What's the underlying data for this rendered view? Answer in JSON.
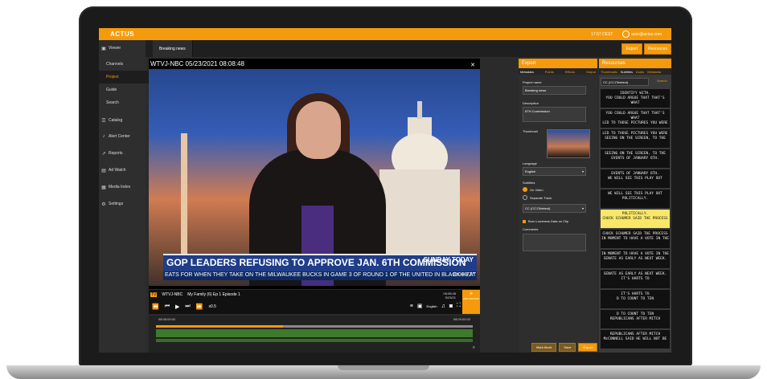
{
  "app": {
    "logo": "ACTUS",
    "top_right_left": "17:57 CEST",
    "user": "user@actus.com"
  },
  "header": {
    "tab": "Breaking news",
    "export_btn": "Export",
    "resources_btn": "Resources"
  },
  "sidebar": {
    "items": [
      {
        "label": "Viewer",
        "icon": "viewer-icon"
      },
      {
        "label": "Channels"
      },
      {
        "label": "Project"
      },
      {
        "label": "Guide"
      },
      {
        "label": "Search"
      },
      {
        "label": "Catalog",
        "icon": "catalog-icon"
      },
      {
        "label": "Alert Center",
        "icon": "bell-icon"
      },
      {
        "label": "Reports",
        "icon": "chart-icon"
      },
      {
        "label": "Ad Watch",
        "icon": "ad-icon"
      },
      {
        "label": "Media Index",
        "icon": "index-icon"
      },
      {
        "label": "Settings",
        "icon": "gear-icon"
      }
    ]
  },
  "player": {
    "title": "WTVJ-NBC  05/23/2021 08:08:48",
    "headline": "GOP LEADERS REFUSING TO APPROVE JAN. 6TH COMMISSION",
    "logo": "SUNDAY TODAY",
    "ticker": "EATS FOR WHEN THEY TAKE ON THE MILWAUKEE BUCKS IN GAME 3 OF ROUND 1 OF THE UNITED IN BLACK HEAT",
    "ticker_time": "8:00  77°",
    "channel": "WTVJ-NBC",
    "program": "My Family (6) Ep 1 Episode 1",
    "timecode": "08:08:48",
    "date": "5/23/21",
    "speed": "x0.5",
    "lang": "English",
    "add_btn": "+",
    "add_label": "ADD MARKER"
  },
  "timeline": {
    "start": "08:08:00:00",
    "end": "08:09:00:00",
    "progress": 0.4
  },
  "export": {
    "header": "Export",
    "tabs": [
      "Metadata",
      "Points",
      "Effects",
      "Output"
    ],
    "project_name_label": "Project name",
    "project_name": "Breaking news",
    "description_label": "Description",
    "description": "6TH Commission",
    "thumbnail_label": "Thumbnail",
    "language_label": "Language",
    "language": "English",
    "subtitles_label": "Subtitles",
    "on_video": "On Video",
    "separate_track": "Separate Track",
    "subtitle_source": "CC (CC1Teletext)",
    "burn_label": "Burn Loudness Data on Clip",
    "comments_label": "Comments",
    "buttons": [
      "Mark Abort",
      "Save",
      "Export"
    ]
  },
  "resources": {
    "header": "Resources",
    "tabs": [
      "Thumbnails",
      "Subtitles",
      "Audio",
      "Metadata"
    ],
    "select": "CC (CC1Teletext)",
    "select_btn": "Search",
    "captions": [
      "IDENTIFY WITH.\nYOU COULD ARGUE THAT THAT'S WHAT",
      "YOU COULD ARGUE THAT THAT'S WHAT\nLED TO THOSE PICTURES YOU WERE",
      "LED TO THOSE PICTURES YOU WERE\nSEEING ON THE SCREEN, TO THE",
      "SEEING ON THE SCREEN, TO THE\nEVENTS OF JANUARY 6TH.",
      "EVENTS OF JANUARY 6TH.\nWE WILL SEE THIS PLAY OUT",
      "WE WILL SEE THIS PLAY OUT\nPOLITICALLY.",
      "POLITICALLY.\nCHUCK SCHUMER SAID THE PROCESS",
      "CHUCK SCHUMER SAID THE PROCESS\nIN MOMENT TO HAVE A VOTE IN THE",
      "IN MOMENT TO HAVE A VOTE IN THE\nSENATE AS EARLY AS NEXT WEEK.",
      "SENATE AS EARLY AS NEXT WEEK.\nIT'S HARTS TO",
      "IT'S HARTS TO\nD TO COUNT TO TEN",
      "D TO COUNT TO TEN\nREPUBLICANS AFTER MITCH",
      "REPUBLICANS AFTER MITCH\nMcCONNELL SAID HE WILL NOT BE"
    ],
    "highlight_index": 6
  }
}
